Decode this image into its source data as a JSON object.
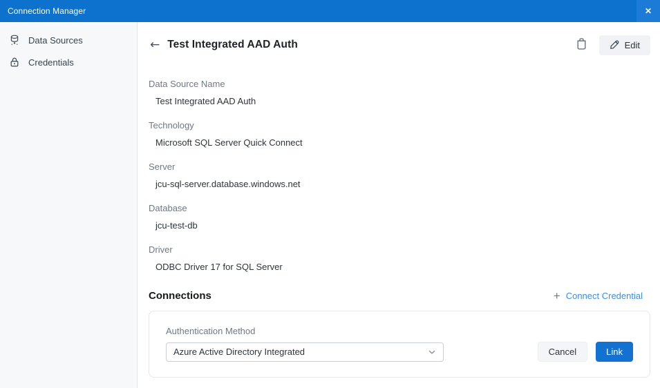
{
  "titlebar": {
    "title": "Connection Manager",
    "close_glyph": "✕"
  },
  "sidebar": {
    "items": [
      {
        "label": "Data Sources",
        "icon": "database-icon"
      },
      {
        "label": "Credentials",
        "icon": "lock-icon"
      }
    ]
  },
  "header": {
    "back_glyph": "←",
    "title": "Test Integrated AAD Auth",
    "edit_label": "Edit"
  },
  "fields": [
    {
      "label": "Data Source Name",
      "value": "Test Integrated AAD Auth"
    },
    {
      "label": "Technology",
      "value": "Microsoft SQL Server Quick Connect"
    },
    {
      "label": "Server",
      "value": "jcu-sql-server.database.windows.net"
    },
    {
      "label": "Database",
      "value": "jcu-test-db"
    },
    {
      "label": "Driver",
      "value": "ODBC Driver 17 for SQL Server"
    }
  ],
  "connections": {
    "heading": "Connections",
    "plus_glyph": "+",
    "connect_credential_label": "Connect Credential"
  },
  "credential_card": {
    "auth_method_label": "Authentication Method",
    "auth_method_value": "Azure Active Directory Integrated",
    "cancel_label": "Cancel",
    "link_label": "Link"
  },
  "colors": {
    "titlebar_blue": "#0d72cd",
    "close_button_blue": "#1b7bd6",
    "primary_button_blue": "#1371d1",
    "link_text_blue": "#3d8de2",
    "sidebar_background": "#f7f8fa",
    "label_gray": "#6e7987"
  }
}
